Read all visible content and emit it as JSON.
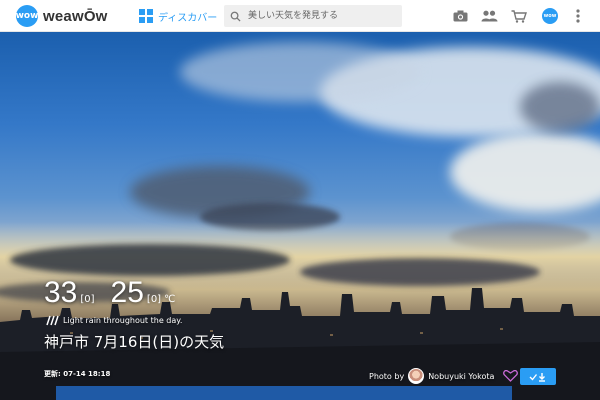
{
  "header": {
    "logo_badge": "wow",
    "logo_text": "weawŌw",
    "discover_label": "ディスカバー",
    "search_placeholder": "美しい天気を発見する",
    "avatar_badge": "wow"
  },
  "weather": {
    "high": "33",
    "high_diff": "[0]",
    "low": "25",
    "low_diff": "[0]",
    "unit": "℃",
    "condition": "Light rain throughout the day.",
    "city_date": "神戸市 7月16日(日)の天気",
    "updated": "更新: 07-14 18:18"
  },
  "photo": {
    "prefix": "Photo by",
    "photographer": "Nobuyuki Yokota"
  },
  "colors": {
    "accent": "#2a9df4",
    "strip": "#1f5aa6"
  },
  "icons": [
    "wow-logo-icon",
    "grid-icon",
    "search-icon",
    "camera-icon",
    "people-icon",
    "cart-icon",
    "more-icon",
    "rain-icon",
    "heart-icon",
    "download-icon"
  ]
}
